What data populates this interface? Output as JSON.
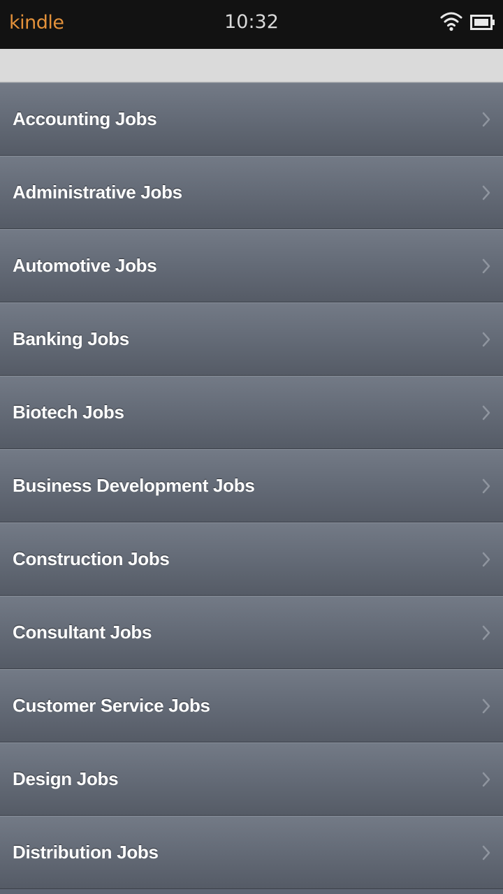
{
  "status_bar": {
    "brand": "kindle",
    "time": "10:32",
    "icons": [
      "wifi-icon",
      "battery-icon"
    ]
  },
  "colors": {
    "status_bar_bg": "#121212",
    "brand": "#e3913a",
    "subheader_bg": "#dadada",
    "row_bg": "#656c78",
    "row_text": "#ffffff"
  },
  "categories": {
    "items": [
      {
        "label": "Accounting Jobs"
      },
      {
        "label": "Administrative Jobs"
      },
      {
        "label": "Automotive Jobs"
      },
      {
        "label": "Banking Jobs"
      },
      {
        "label": "Biotech Jobs"
      },
      {
        "label": "Business Development Jobs"
      },
      {
        "label": "Construction Jobs"
      },
      {
        "label": "Consultant Jobs"
      },
      {
        "label": "Customer Service Jobs"
      },
      {
        "label": "Design Jobs"
      },
      {
        "label": "Distribution Jobs"
      }
    ],
    "row_icon": "chevron-right-icon"
  }
}
